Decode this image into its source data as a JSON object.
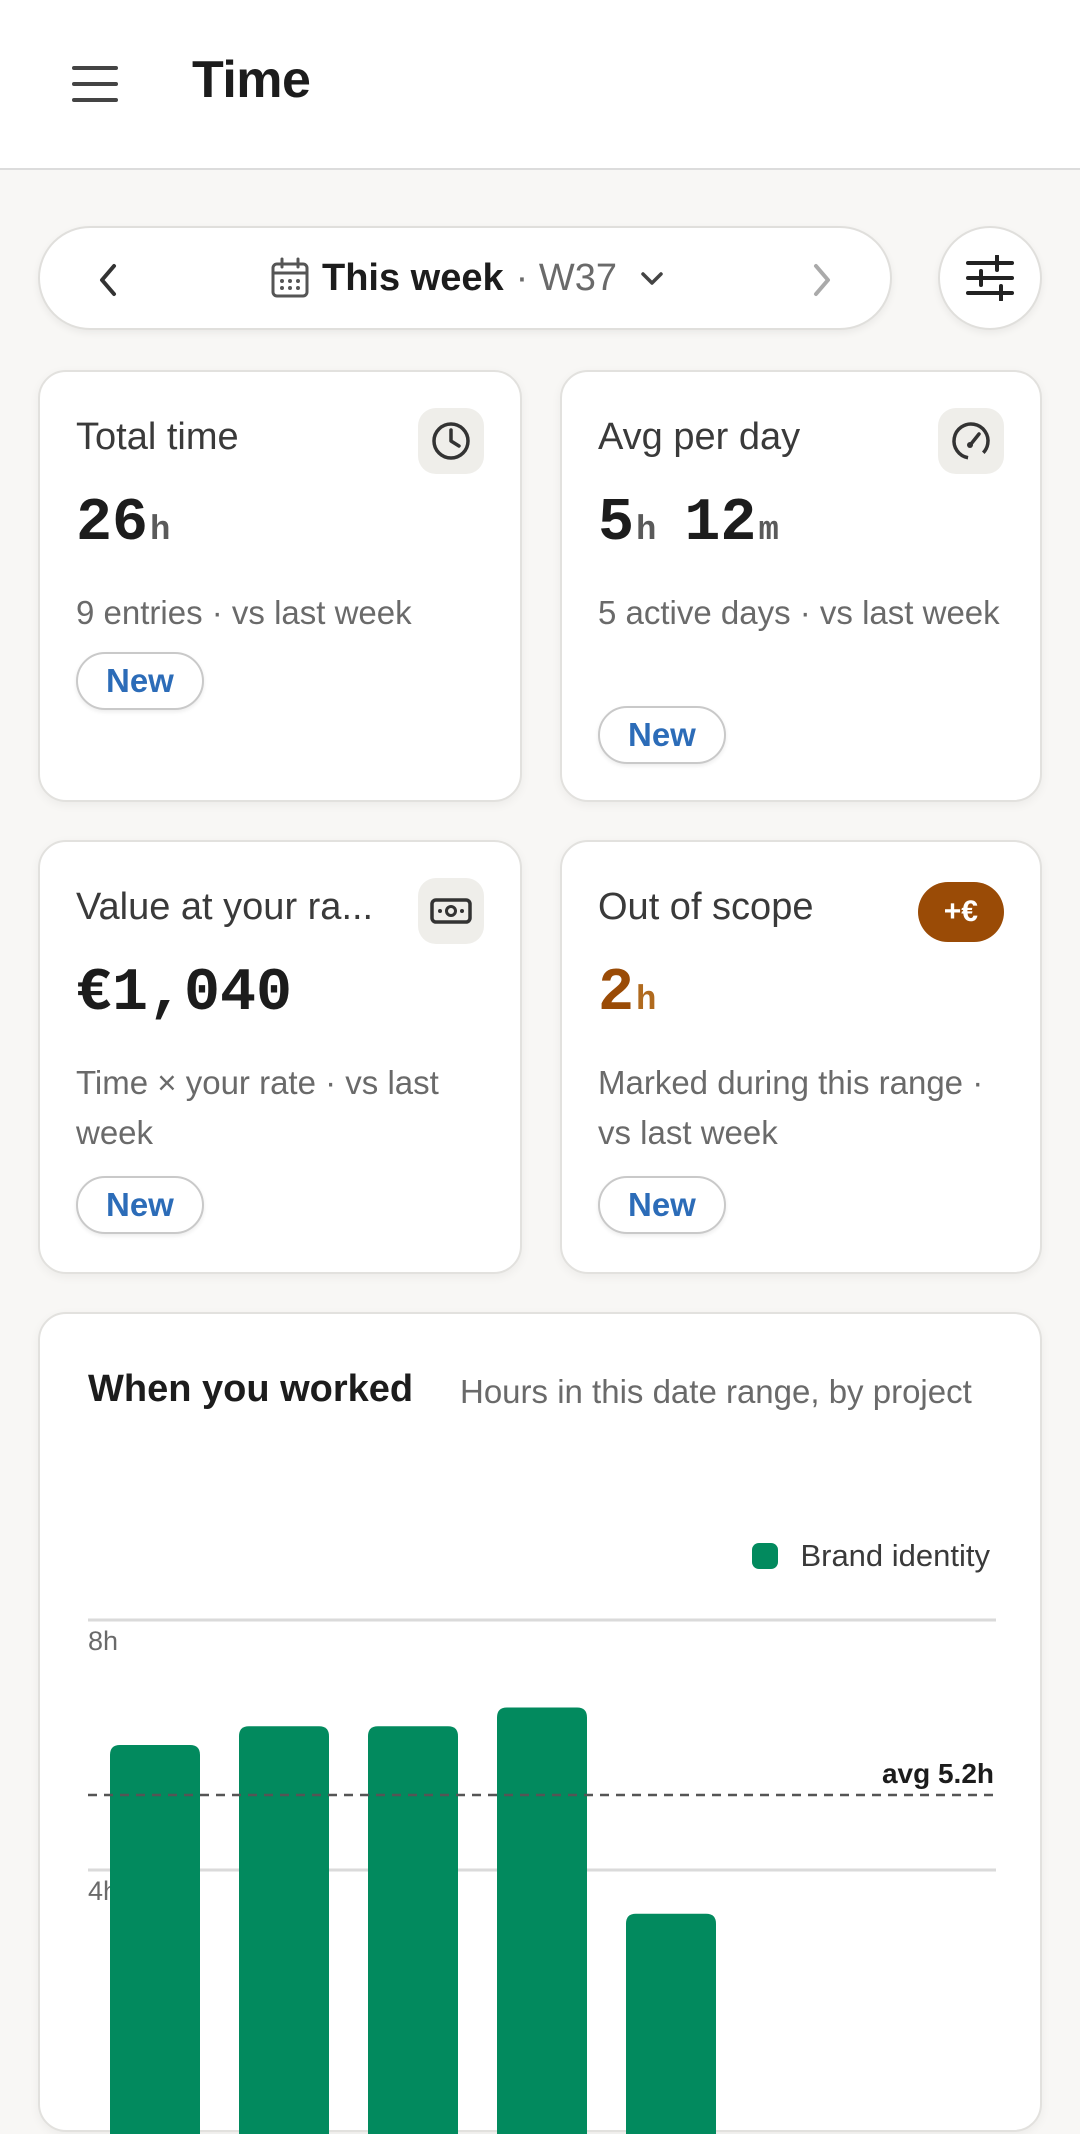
{
  "header": {
    "title": "Time",
    "menu_icon": "menu-icon"
  },
  "range": {
    "label": "This week",
    "week": "· W37",
    "calendar_icon": "calendar-icon",
    "prev_icon": "chevron-left-icon",
    "next_icon": "chevron-right-icon",
    "dropdown_icon": "chevron-down-icon",
    "filter_icon": "sliders-icon"
  },
  "cards": [
    {
      "title": "Total time",
      "value": "26",
      "unit": "h",
      "sub": "9 entries · vs last week",
      "pill": "New",
      "icon": "clock-icon"
    },
    {
      "title": "Avg per day",
      "value_h": "5",
      "unit_h": "h",
      "value_m": "12",
      "unit_m": "m",
      "sub": "5 active days · vs last week",
      "pill": "New",
      "icon": "gauge-icon"
    },
    {
      "title": "Value at your ra...",
      "value": "€1,040",
      "sub": "Time × your rate · vs last week",
      "pill": "New",
      "icon": "cash-icon"
    },
    {
      "title": "Out of scope",
      "value": "2",
      "unit": "h",
      "sub": "Marked during this range · vs last week",
      "pill": "New",
      "badge": "+€"
    }
  ],
  "chart": {
    "title": "When you worked",
    "subtitle": "Hours in this date range, by project",
    "avg_label": "avg 5.2h",
    "accent": "#028a5e"
  },
  "chart_data": {
    "type": "bar",
    "series": [
      {
        "name": "Brand identity",
        "values": [
          6.0,
          6.3,
          6.3,
          6.6,
          3.3
        ]
      }
    ],
    "y_ticks": [
      "8h",
      "4h"
    ],
    "y_tick_values": [
      8,
      4
    ],
    "average": 5.2,
    "legend_position": "top-right",
    "grid": true
  }
}
